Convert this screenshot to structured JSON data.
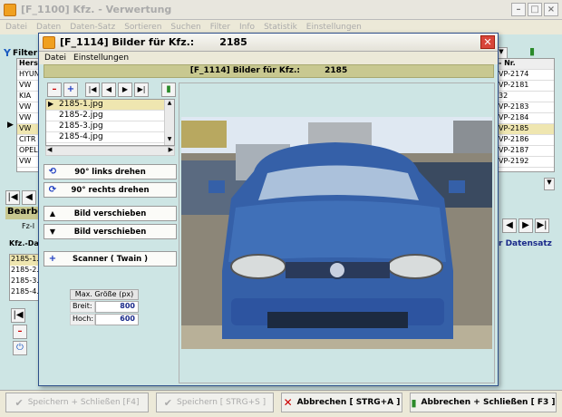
{
  "main_window": {
    "title": "[F_1100] Kfz. - Verwertung",
    "menu": [
      "Datei",
      "Daten",
      "Daten-Satz",
      "Sortieren",
      "Suchen",
      "Filter",
      "Info",
      "Statistik",
      "Einstellungen"
    ],
    "filter_label": "Filter",
    "list_header": "Herst",
    "makes": [
      "HYUN",
      "VW",
      "KIA",
      "VW",
      "VW",
      "VW",
      "CITR",
      "OPEL",
      "VW"
    ],
    "selected_index": 5,
    "nr_header": "- Nr.",
    "numbers": [
      "VP-2174",
      "VP-2181",
      "32",
      "VP-2183",
      "VP-2184",
      "VP-2185",
      "VP-2186",
      "VP-2187",
      "VP-2192"
    ],
    "bearbeiten_label": "Bearbe",
    "fz_label": "Fz-I",
    "kfz_dat_label": "Kfz.-Dat",
    "kfz_dat_rows": [
      "2185-1.",
      "2185-2.",
      "2185-3.",
      "2185-4."
    ],
    "datensatz_label": "Datensatz",
    "bottom_buttons": {
      "save_close": "Speichern + Schließen [F4]",
      "save": "Speichern [ STRG+S ]",
      "cancel": "Abbrechen [ STRG+A ]",
      "cancel_close": "Abbrechen + Schließen [ F3 ]"
    }
  },
  "dialog": {
    "title": "[F_1114] Bilder für Kfz.:",
    "kfz_number": "2185",
    "menu": [
      "Datei",
      "Einstellungen"
    ],
    "header": "[F_1114] Bilder für Kfz.:",
    "header_number": "2185",
    "files": [
      "2185-1.jpg",
      "2185-2.jpg",
      "2185-3.jpg",
      "2185-4.jpg"
    ],
    "selected_file": 0,
    "buttons": {
      "rotate_left": "90° links drehen",
      "rotate_right": "90° rechts drehen",
      "move_up": "Bild verschieben",
      "move_down": "Bild verschieben",
      "scanner": "Scanner ( Twain )"
    },
    "max_size": {
      "title": "Max. Größe (px)",
      "width_label": "Breit:",
      "width_value": "800",
      "height_label": "Hoch:",
      "height_value": "600"
    }
  },
  "colors": {
    "panel": "#cde5e4",
    "header": "#c8c890",
    "selection": "#efe6b0",
    "car": "#3560a8"
  }
}
